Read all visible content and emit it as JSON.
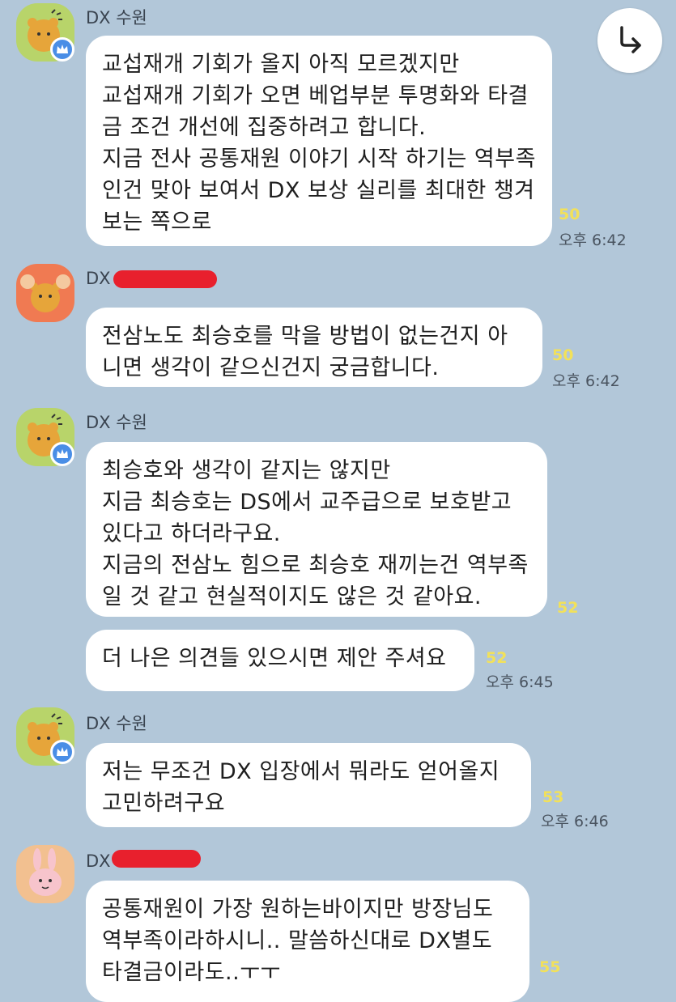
{
  "scroll_button": {
    "icon": "arrow-turn-right-icon"
  },
  "messages": [
    {
      "sender": "DX 수원",
      "avatar": "ryan-character-avatar",
      "badge": "crown-icon",
      "bubbles": [
        {
          "text": "교섭재개 기회가 올지 아직 모르겠지만\n교섭재개 기회가 오면 베업부분 투명화와 타결금 조건 개선에 집중하려고 합니다.\n지금 전사 공통재원 이야기 시작 하기는 역부족인건 맞아 보여서 DX 보상 실리를 최대한 챙겨보는 쪽으로",
          "unread": "50",
          "time": "오후 6:42"
        }
      ]
    },
    {
      "sender": "DX",
      "avatar": "ryan-cheer-avatar",
      "bubbles": [
        {
          "text": "전삼노도 최승호를 막을 방법이 없는건지 아니면 생각이 같으신건지 궁금합니다.",
          "unread": "50",
          "time": "오후 6:42"
        }
      ]
    },
    {
      "sender": "DX 수원",
      "avatar": "ryan-character-avatar",
      "badge": "crown-icon",
      "bubbles": [
        {
          "text": "최승호와 생각이 같지는 않지만\n지금 최승호는 DS에서 교주급으로 보호받고 있다고 하더라구요.\n지금의 전삼노 힘으로 최승호 재끼는건 역부족일 것 같고 현실적이지도 않은 것 같아요.",
          "unread": "52"
        },
        {
          "text": "더 나은 의견들 있으시면 제안 주셔요",
          "unread": "52",
          "time": "오후 6:45"
        }
      ]
    },
    {
      "sender": "DX 수원",
      "avatar": "ryan-character-avatar",
      "badge": "crown-icon",
      "bubbles": [
        {
          "text": "저는 무조건 DX 입장에서 뭐라도 얻어올지 고민하려구요",
          "unread": "53",
          "time": "오후 6:46"
        }
      ]
    },
    {
      "sender": "DX",
      "avatar": "pink-bunny-avatar",
      "bubbles": [
        {
          "text": "공통재원이 가장 원하는바이지만 방장님도 역부족이라하시니.. 말씀하신대로 DX별도 타결금이라도..ㅜㅜ",
          "unread": "55"
        }
      ]
    }
  ]
}
